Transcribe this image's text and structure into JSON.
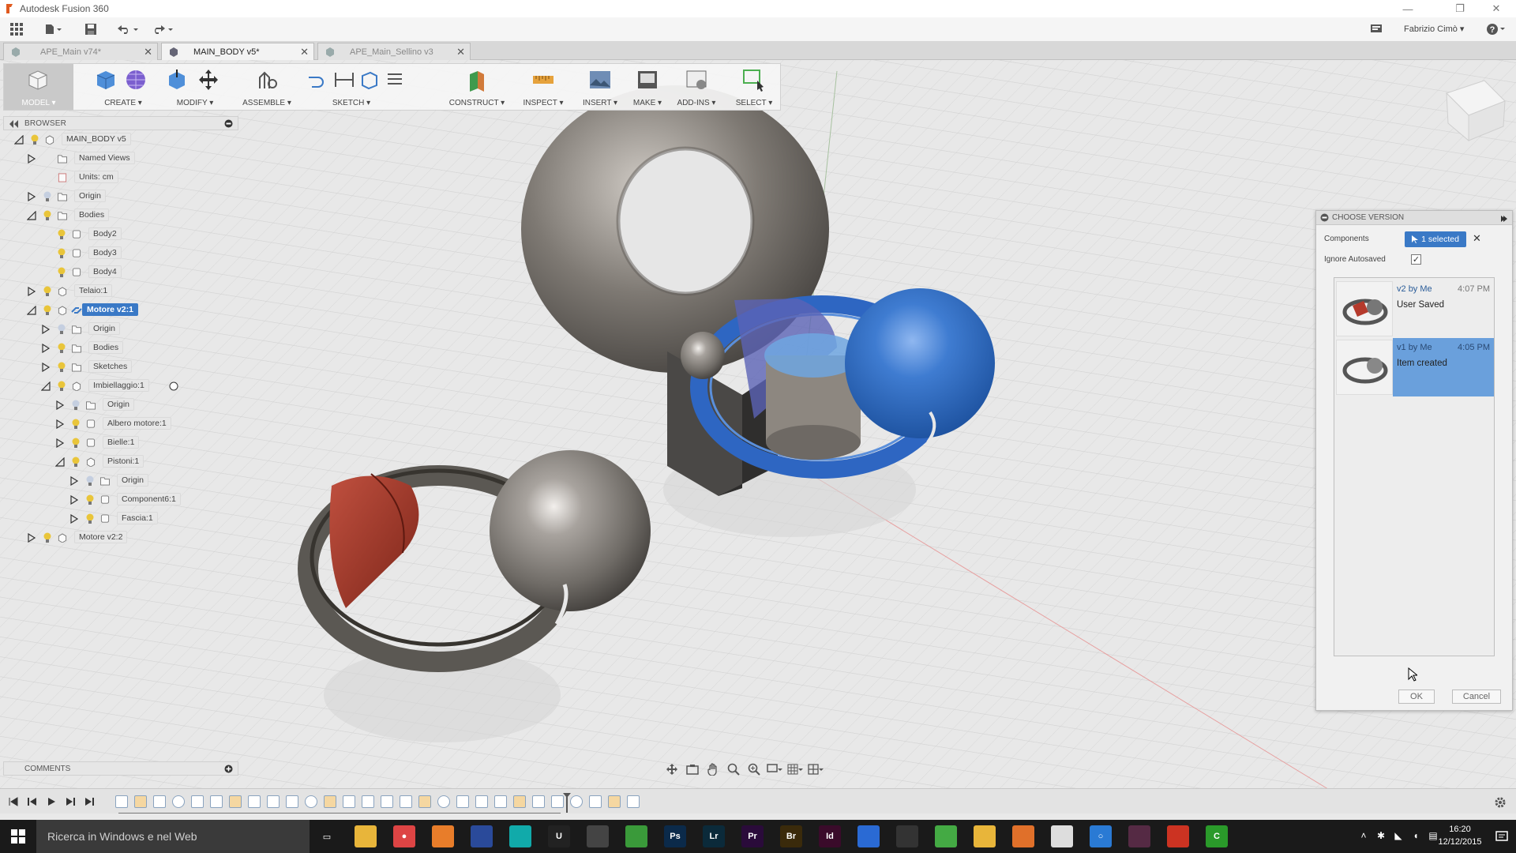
{
  "window": {
    "title": "Autodesk Fusion 360"
  },
  "user": {
    "name": "Fabrizio Cimò ▾"
  },
  "tabs": [
    {
      "label": "APE_Main v74*",
      "active": false
    },
    {
      "label": "MAIN_BODY v5*",
      "active": true
    },
    {
      "label": "APE_Main_Sellino v3",
      "active": false
    }
  ],
  "toolbar": {
    "groups": [
      {
        "label": "MODEL ▾"
      },
      {
        "label": "CREATE ▾"
      },
      {
        "label": "MODIFY ▾"
      },
      {
        "label": "ASSEMBLE ▾"
      },
      {
        "label": "SKETCH ▾"
      },
      {
        "label": "CONSTRUCT ▾"
      },
      {
        "label": "INSPECT ▾"
      },
      {
        "label": "INSERT ▾"
      },
      {
        "label": "MAKE ▾"
      },
      {
        "label": "ADD-INS ▾"
      },
      {
        "label": "SELECT ▾"
      }
    ]
  },
  "browser": {
    "title": "BROWSER",
    "tree": [
      {
        "label": "MAIN_BODY v5"
      },
      {
        "label": "Named Views"
      },
      {
        "label": "Units: cm"
      },
      {
        "label": "Origin"
      },
      {
        "label": "Bodies"
      },
      {
        "label": "Body2"
      },
      {
        "label": "Body3"
      },
      {
        "label": "Body4"
      },
      {
        "label": "Telaio:1"
      },
      {
        "label": "Motore v2:1"
      },
      {
        "label": "Origin"
      },
      {
        "label": "Bodies"
      },
      {
        "label": "Sketches"
      },
      {
        "label": "Imbiellaggio:1"
      },
      {
        "label": "Origin"
      },
      {
        "label": "Albero motore:1"
      },
      {
        "label": "Bielle:1"
      },
      {
        "label": "Pistoni:1"
      },
      {
        "label": "Origin"
      },
      {
        "label": "Component6:1"
      },
      {
        "label": "Fascia:1"
      },
      {
        "label": "Motore v2:2"
      }
    ]
  },
  "comments": {
    "title": "COMMENTS"
  },
  "dialog": {
    "title": "CHOOSE VERSION",
    "components_label": "Components",
    "selected_label": "1 selected",
    "ignore_autosaved_label": "Ignore Autosaved",
    "ignore_autosaved_checked": true,
    "versions": [
      {
        "version": "v2",
        "by": "by Me",
        "time": "4:07 PM",
        "desc": "User Saved",
        "selected": false
      },
      {
        "version": "v1",
        "by": "by Me",
        "time": "4:05 PM",
        "desc": "Item created",
        "selected": true
      }
    ],
    "ok_label": "OK",
    "cancel_label": "Cancel"
  },
  "taskbar": {
    "search_placeholder": "Ricerca in Windows e nel Web",
    "time": "16:20",
    "date": "12/12/2015"
  },
  "colors": {
    "selection": "#3a79c6",
    "version_selected": "#6aa0dc",
    "taskbar": "#1a1a1a"
  }
}
